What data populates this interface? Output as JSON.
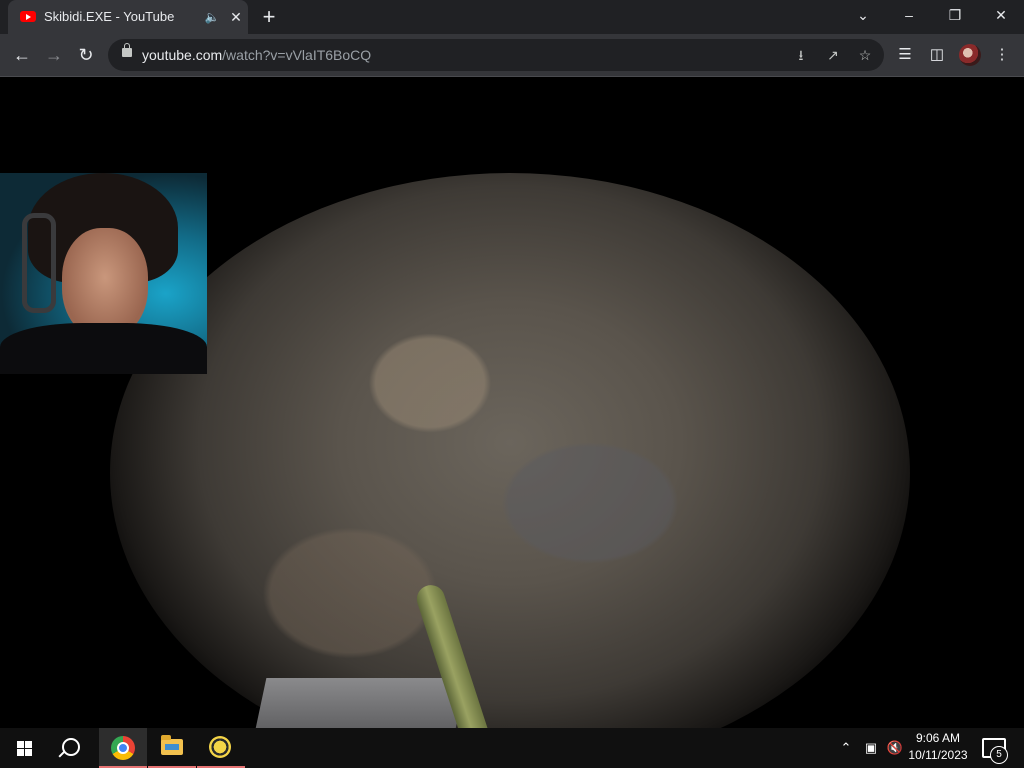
{
  "browser": {
    "tab": {
      "title": "Skibidi.EXE - YouTube"
    },
    "omnibox": {
      "host": "youtube.com",
      "path": "/watch?v=vVlaIT6BoCQ"
    }
  },
  "taskbar": {
    "clock": {
      "time": "9:06 AM",
      "date": "10/11/2023"
    },
    "notification_count": "5"
  }
}
